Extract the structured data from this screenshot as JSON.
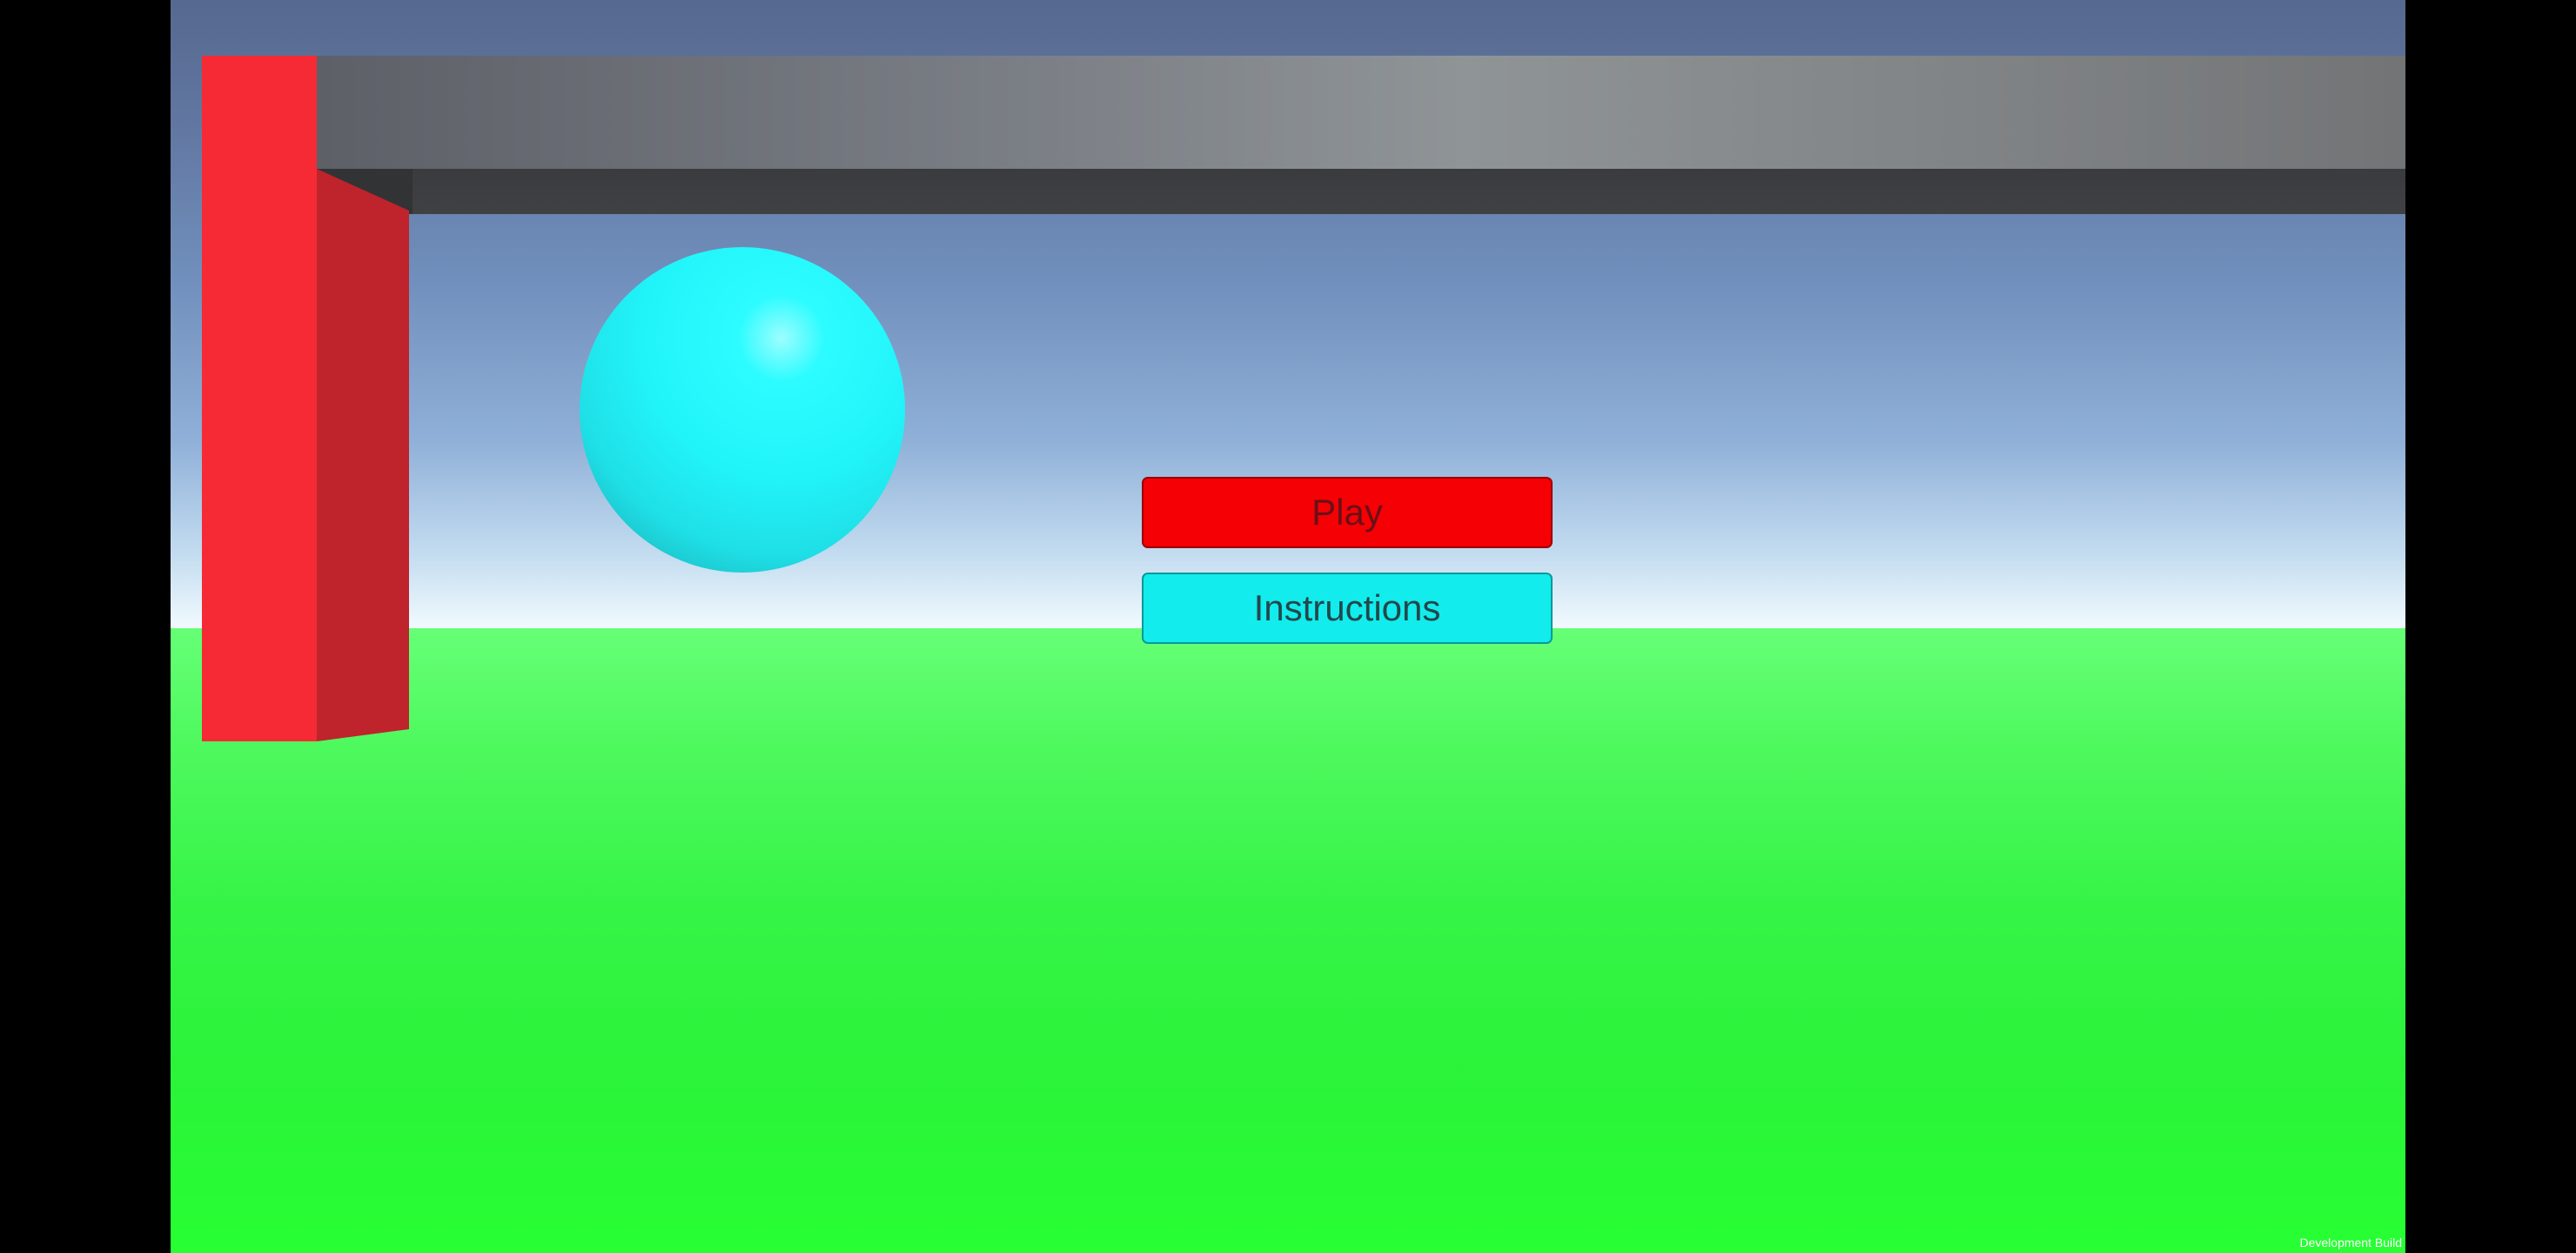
{
  "scene": {
    "colors": {
      "background": "#000000",
      "sky_top": "#56698f",
      "sky_horizon": "#f2fbff",
      "ground": "#2bf33a",
      "beam": "#808385",
      "pillar": "#f52a34",
      "ball": "#21f4f9"
    }
  },
  "menu": {
    "play_label": "Play",
    "play_color": "#f50005",
    "instructions_label": "Instructions",
    "instructions_color": "#12ecec"
  },
  "overlay": {
    "build_label": "Development Build"
  }
}
